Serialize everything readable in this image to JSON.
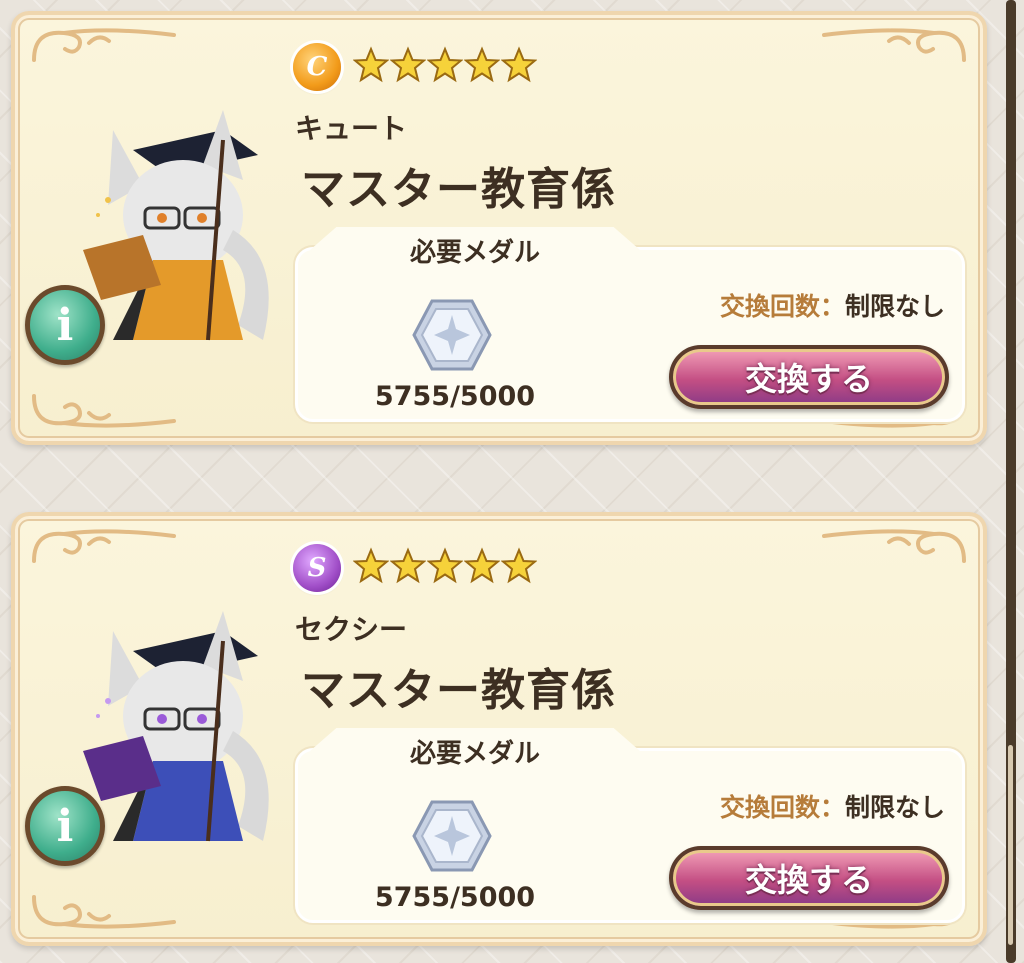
{
  "cards": [
    {
      "type_letter": "C",
      "type_color": "#f29b1a",
      "rarity_stars": 5,
      "attribute": "キュート",
      "name": "マスター教育係",
      "medal_header": "必要メダル",
      "medal_count": "5755/5000",
      "limit_label": "交換回数：",
      "limit_value": "制限なし",
      "exchange_label": "交換する",
      "info_label": "i",
      "robe_color": "#e49a2a",
      "book_color": "#b8742a",
      "eye_color": "#e0802a"
    },
    {
      "type_letter": "S",
      "type_color": "#a14fc8",
      "rarity_stars": 5,
      "attribute": "セクシー",
      "name": "マスター教育係",
      "medal_header": "必要メダル",
      "medal_count": "5755/5000",
      "limit_label": "交換回数：",
      "limit_value": "制限なし",
      "exchange_label": "交換する",
      "info_label": "i",
      "robe_color": "#3d4fb8",
      "book_color": "#5a2e8a",
      "eye_color": "#9a5ad8"
    }
  ]
}
